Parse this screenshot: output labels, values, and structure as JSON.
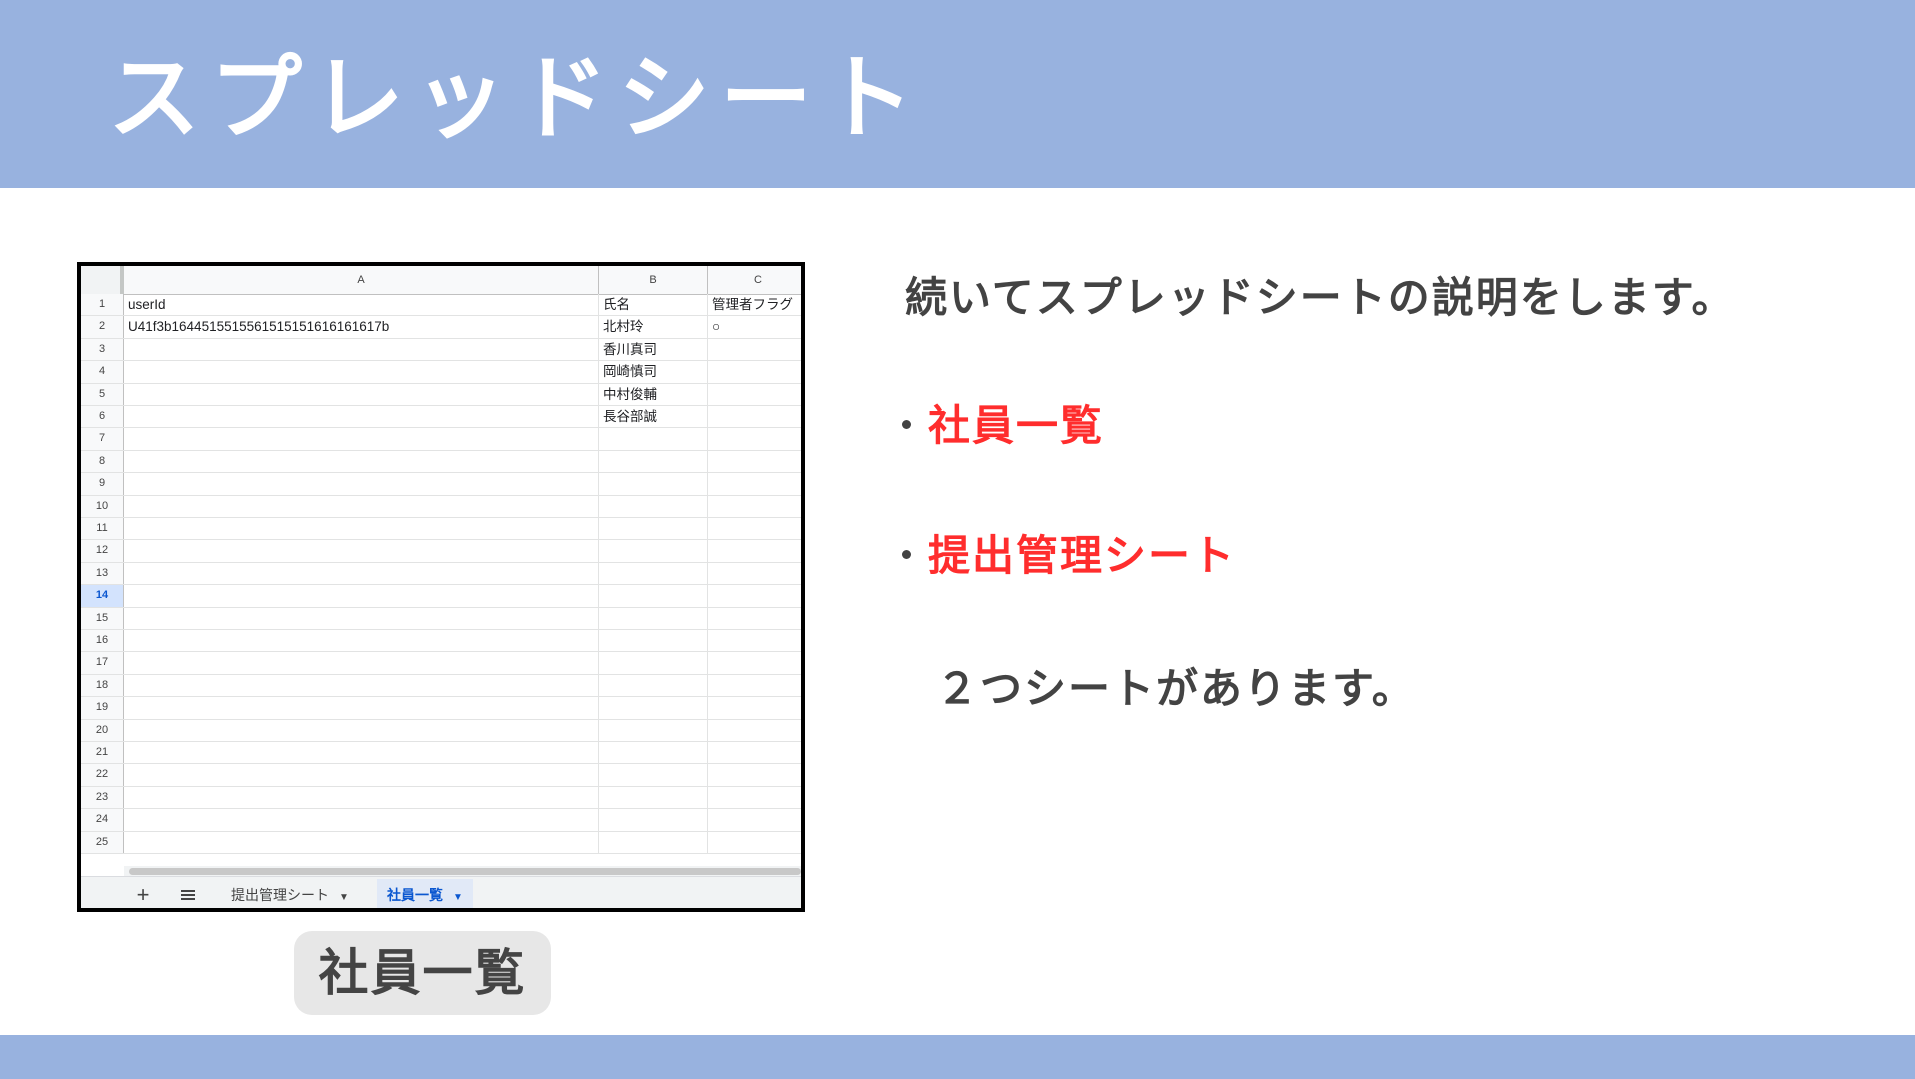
{
  "header": {
    "title": "スプレッドシート"
  },
  "spreadsheet": {
    "column_headers": [
      "A",
      "B",
      "C"
    ],
    "row_numbers": [
      "1",
      "2",
      "3",
      "4",
      "5",
      "6",
      "7",
      "8",
      "9",
      "10",
      "11",
      "12",
      "13",
      "14",
      "15",
      "16",
      "17",
      "18",
      "19",
      "20",
      "21",
      "22",
      "23",
      "24",
      "25"
    ],
    "selected_row": "14",
    "rows": [
      [
        "userId",
        "氏名",
        "管理者フラグ"
      ],
      [
        "U41f3b1644515515561515151616161617b",
        "北村玲",
        "○"
      ],
      [
        "",
        "香川真司",
        ""
      ],
      [
        "",
        "岡崎慎司",
        ""
      ],
      [
        "",
        "中村俊輔",
        ""
      ],
      [
        "",
        "長谷部誠",
        ""
      ]
    ],
    "tab_add_label": "+",
    "tabs": [
      {
        "label": "提出管理シート",
        "active": false
      },
      {
        "label": "社員一覧",
        "active": true
      }
    ]
  },
  "caption": "社員一覧",
  "content": {
    "intro": "続いてスプレッドシートの説明をします。",
    "bullets": [
      "社員一覧",
      "提出管理シート"
    ],
    "outro": "２つシートがあります。"
  },
  "colors": {
    "band": "#98b2df",
    "highlight": "#ff2d2d",
    "text": "#434343",
    "active_tab": "#0b57d0"
  }
}
